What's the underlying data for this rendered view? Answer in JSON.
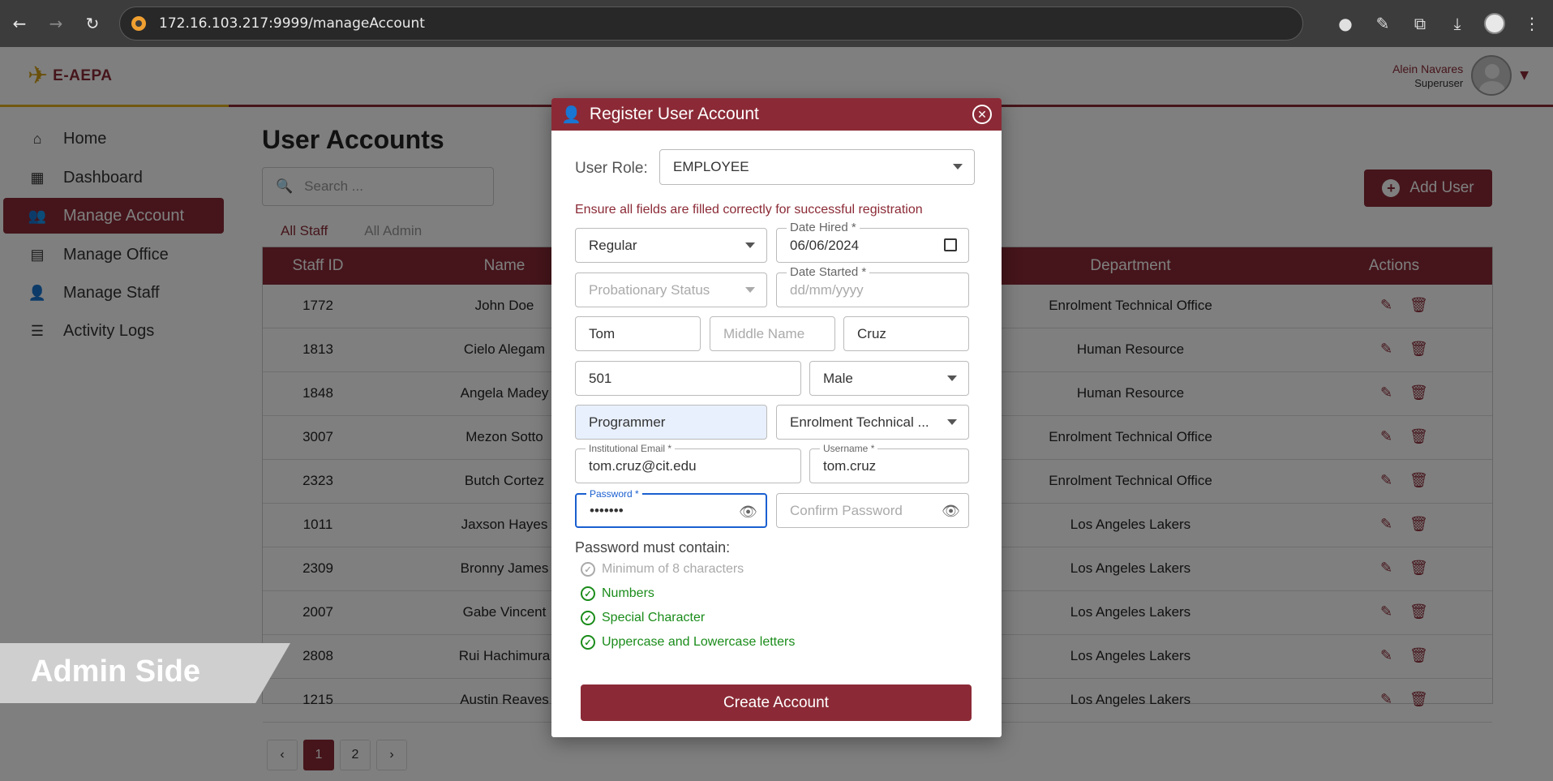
{
  "browser": {
    "url": "172.16.103.217:9999/manageAccount"
  },
  "header": {
    "logo_text": "E-AEPA",
    "user_name": "Alein Navares",
    "user_role": "Superuser"
  },
  "sidebar": {
    "items": [
      {
        "label": "Home",
        "icon": "home-icon"
      },
      {
        "label": "Dashboard",
        "icon": "dashboard-icon"
      },
      {
        "label": "Manage Account",
        "icon": "users-icon"
      },
      {
        "label": "Manage Office",
        "icon": "building-icon"
      },
      {
        "label": "Manage Staff",
        "icon": "person-icon"
      },
      {
        "label": "Activity Logs",
        "icon": "list-icon"
      }
    ]
  },
  "main": {
    "title": "User Accounts",
    "search_placeholder": "Search ...",
    "add_user_label": "Add User",
    "tabs": [
      "All Staff",
      "All Admin"
    ],
    "columns": [
      "Staff ID",
      "Name",
      "Department",
      "Actions"
    ],
    "rows": [
      {
        "id": "1772",
        "name": "John Doe",
        "dept": "Enrolment Technical Office"
      },
      {
        "id": "1813",
        "name": "Cielo Alegam",
        "dept": "Human Resource"
      },
      {
        "id": "1848",
        "name": "Angela Madey",
        "dept": "Human Resource"
      },
      {
        "id": "3007",
        "name": "Mezon Sotto",
        "dept": "Enrolment Technical Office"
      },
      {
        "id": "2323",
        "name": "Butch Cortez",
        "dept": "Enrolment Technical Office"
      },
      {
        "id": "1011",
        "name": "Jaxson Hayes",
        "dept": "Los Angeles Lakers"
      },
      {
        "id": "2309",
        "name": "Bronny James",
        "dept": "Los Angeles Lakers"
      },
      {
        "id": "2007",
        "name": "Gabe Vincent",
        "dept": "Los Angeles Lakers"
      },
      {
        "id": "2808",
        "name": "Rui Hachimura",
        "dept": "Los Angeles Lakers"
      },
      {
        "id": "1215",
        "name": "Austin Reaves",
        "dept": "Los Angeles Lakers"
      }
    ],
    "pages": [
      "‹",
      "1",
      "2",
      "›"
    ]
  },
  "banner": {
    "text": "Admin Side"
  },
  "modal": {
    "title": "Register User Account",
    "role_label": "User Role:",
    "role_value": "EMPLOYEE",
    "warning": "Ensure all fields are filled correctly for successful registration",
    "employment_type": "Regular",
    "date_hired_label": "Date Hired  *",
    "date_hired_value": "06/06/2024",
    "probation_placeholder": "Probationary Status",
    "date_started_label": "Date Started  *",
    "date_started_placeholder": "dd/mm/yyyy",
    "first_name": "Tom",
    "middle_name_placeholder": "Middle Name",
    "last_name": "Cruz",
    "staff_id": "501",
    "gender": "Male",
    "position": "Programmer",
    "department": "Enrolment Technical ...",
    "email_label": "Institutional Email *",
    "email_value": "tom.cruz@cit.edu",
    "username_label": "Username *",
    "username_value": "tom.cruz",
    "password_label": "Password *",
    "password_value": "•••••••",
    "confirm_placeholder": "Confirm Password",
    "pw_title": "Password must contain:",
    "rules": [
      {
        "text": "Minimum of 8 characters",
        "met": false
      },
      {
        "text": "Numbers",
        "met": true
      },
      {
        "text": "Special Character",
        "met": true
      },
      {
        "text": "Uppercase and Lowercase letters",
        "met": true
      }
    ],
    "submit_label": "Create Account"
  },
  "colors": {
    "brand": "#8b2a36",
    "valid": "#1a8c1a",
    "focus": "#1a5fd0"
  }
}
